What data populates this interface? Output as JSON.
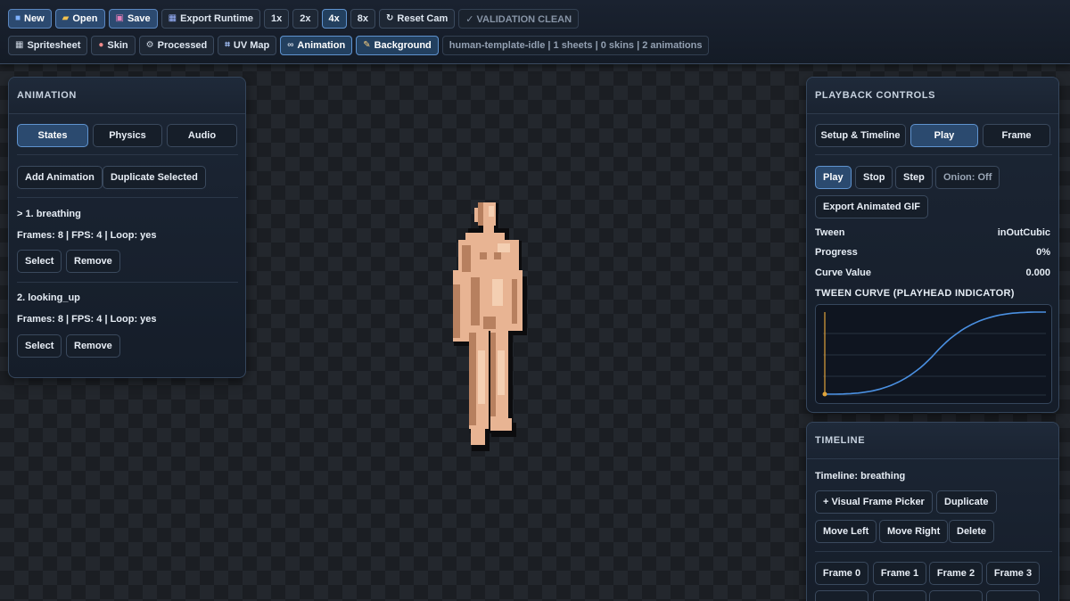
{
  "toolbar": {
    "row1": {
      "new": "New",
      "open": "Open",
      "save": "Save",
      "export_runtime": "Export Runtime",
      "zoom_1x": "1x",
      "zoom_2x": "2x",
      "zoom_4x": "4x",
      "zoom_8x": "8x",
      "reset_cam": "Reset Cam",
      "validation": "✓ VALIDATION CLEAN"
    },
    "row2": {
      "spritesheet": "Spritesheet",
      "skin": "Skin",
      "processed": "Processed",
      "uv_map": "UV Map",
      "animation": "Animation",
      "background": "Background",
      "project_info": "human-template-idle | 1 sheets | 0 skins | 2 animations"
    },
    "active_zoom": "4x"
  },
  "animation_panel": {
    "title": "ANIMATION",
    "tabs": {
      "states": "States",
      "physics": "Physics",
      "audio": "Audio"
    },
    "add_animation": "Add Animation",
    "duplicate_selected": "Duplicate Selected",
    "items": [
      {
        "name": "> 1. breathing",
        "meta": "Frames: 8 | FPS: 4 | Loop: yes",
        "select": "Select",
        "remove": "Remove"
      },
      {
        "name": "2. looking_up",
        "meta": "Frames: 8 | FPS: 4 | Loop: yes",
        "select": "Select",
        "remove": "Remove"
      }
    ]
  },
  "playback_panel": {
    "title": "PLAYBACK CONTROLS",
    "tabs": {
      "setup": "Setup & Timeline",
      "play": "Play",
      "frame": "Frame"
    },
    "buttons": {
      "play": "Play",
      "stop": "Stop",
      "step": "Step",
      "onion": "Onion: Off",
      "export_gif": "Export Animated GIF"
    },
    "tween_label": "Tween",
    "tween_value": "inOutCubic",
    "progress_label": "Progress",
    "progress_value": "0%",
    "curve_label": "Curve Value",
    "curve_value": "0.000",
    "curve_title": "TWEEN CURVE (PLAYHEAD INDICATOR)",
    "playhead_progress": 0,
    "curve_color": "#4a90e2",
    "playhead_color": "#e0a43a"
  },
  "timeline_panel": {
    "title": "TIMELINE",
    "timeline_label": "Timeline: breathing",
    "buttons": {
      "visual_frame_picker": "+ Visual Frame Picker",
      "duplicate": "Duplicate",
      "move_left": "Move Left",
      "move_right": "Move Right",
      "delete": "Delete"
    },
    "frames": [
      "Frame 0",
      "Frame 1",
      "Frame 2",
      "Frame 3"
    ]
  },
  "colors": {
    "accent": "#5f93cf",
    "skin": "#e8b493"
  }
}
